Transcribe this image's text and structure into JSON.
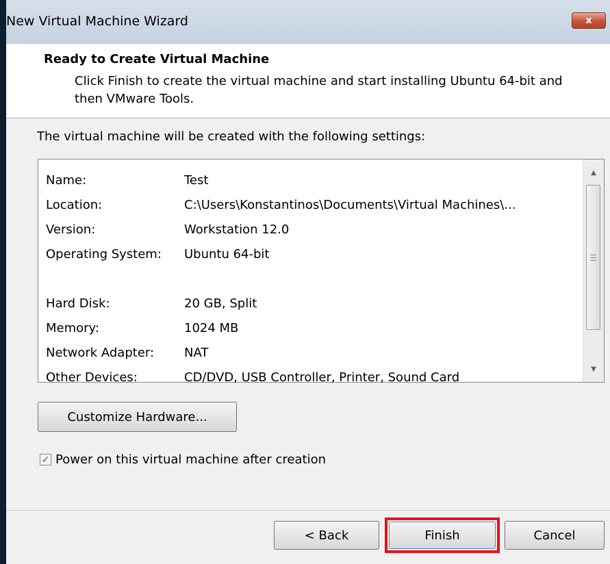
{
  "window": {
    "title": "New Virtual Machine Wizard",
    "close_label": "x"
  },
  "header": {
    "title": "Ready to Create Virtual Machine",
    "description": "Click Finish to create the virtual machine and start installing Ubuntu 64-bit and then VMware Tools."
  },
  "intro": "The virtual machine will be created with the following settings:",
  "settings": [
    {
      "label": "Name:",
      "value": "Test"
    },
    {
      "label": "Location:",
      "value": "C:\\Users\\Konstantinos\\Documents\\Virtual Machines\\..."
    },
    {
      "label": "Version:",
      "value": "Workstation 12.0"
    },
    {
      "label": "Operating System:",
      "value": "Ubuntu 64-bit"
    },
    {
      "label": "Hard Disk:",
      "value": "20 GB, Split"
    },
    {
      "label": "Memory:",
      "value": "1024 MB"
    },
    {
      "label": "Network Adapter:",
      "value": "NAT"
    },
    {
      "label": "Other Devices:",
      "value": "CD/DVD, USB Controller, Printer, Sound Card"
    }
  ],
  "buttons": {
    "customize": "Customize Hardware...",
    "back": "< Back",
    "finish": "Finish",
    "cancel": "Cancel"
  },
  "power_on": {
    "label": "Power on this virtual machine after creation",
    "checked": true
  },
  "colors": {
    "highlight": "#e8111a",
    "close_button": "#c5533d"
  }
}
